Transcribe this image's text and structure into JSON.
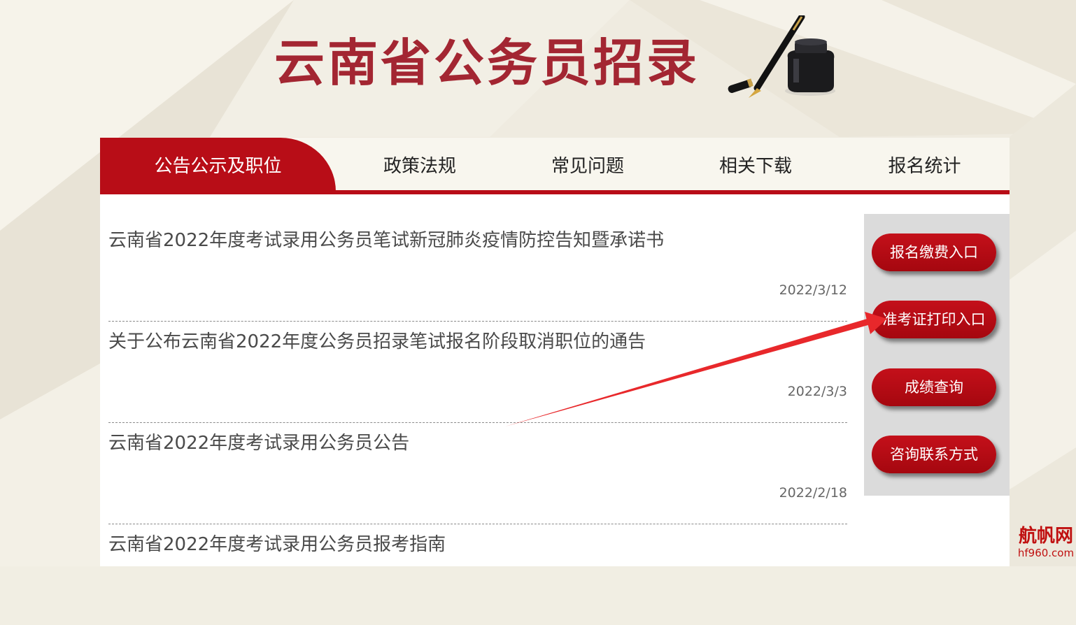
{
  "header": {
    "site_title": "云南省公务员招录"
  },
  "nav": {
    "tabs": [
      {
        "label": "公告公示及职位",
        "active": true
      },
      {
        "label": "政策法规",
        "active": false
      },
      {
        "label": "常见问题",
        "active": false
      },
      {
        "label": "相关下载",
        "active": false
      },
      {
        "label": "报名统计",
        "active": false
      }
    ]
  },
  "news": [
    {
      "title": "云南省2022年度考试录用公务员笔试新冠肺炎疫情防控告知暨承诺书",
      "date": "2022/3/12"
    },
    {
      "title": "关于公布云南省2022年度公务员招录笔试报名阶段取消职位的通告",
      "date": "2022/3/3"
    },
    {
      "title": "云南省2022年度考试录用公务员公告",
      "date": "2022/2/18"
    },
    {
      "title": "云南省2022年度考试录用公务员报考指南",
      "date": ""
    }
  ],
  "sidebar": {
    "buttons": [
      {
        "label": "报名缴费入口"
      },
      {
        "label": "准考证打印入口"
      },
      {
        "label": "成绩查询"
      },
      {
        "label": "咨询联系方式"
      }
    ]
  },
  "watermark": {
    "text": "航帆网",
    "url": "hf960.com"
  },
  "colors": {
    "brand_red": "#b80d17",
    "title_red": "#a32632",
    "arrow_red": "#e8282b"
  }
}
